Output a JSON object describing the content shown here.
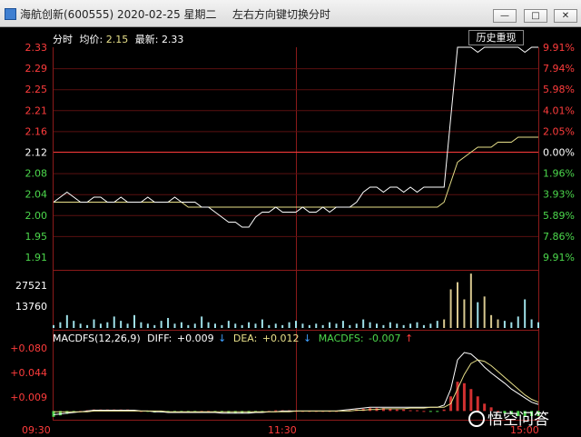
{
  "window": {
    "title": "海航创新(600555)  2020-02-25  星期二",
    "hint": "左右方向键切换分时",
    "min_glyph": "—",
    "max_glyph": "□",
    "close_glyph": "✕"
  },
  "info": {
    "mode": "分时",
    "avg_label": "均价:",
    "avg_value": "2.15",
    "latest_label": "最新:",
    "latest_value": "2.33"
  },
  "history_button": "历史重现",
  "price_axis": {
    "left": [
      "2.33",
      "2.29",
      "2.25",
      "2.21",
      "2.16",
      "2.12",
      "2.08",
      "2.04",
      "2.00",
      "1.95",
      "1.91"
    ],
    "right": [
      "9.91%",
      "7.94%",
      "5.98%",
      "4.01%",
      "2.05%",
      "0.00%",
      "1.96%",
      "3.93%",
      "5.89%",
      "7.86%",
      "9.91%"
    ]
  },
  "volume_axis": [
    "27521",
    "13760"
  ],
  "macd": {
    "title": "MACDFS(12,26,9)",
    "diff_label": "DIFF:",
    "diff_value": "+0.009",
    "dea_label": "DEA:",
    "dea_value": "+0.012",
    "macdfs_label": "MACDFS:",
    "macdfs_value": "-0.007",
    "axis": [
      "+0.080",
      "+0.044",
      "+0.009"
    ]
  },
  "time_axis": [
    "09:30",
    "11:30",
    "15:00"
  ],
  "watermark": "悟空问答",
  "colors": {
    "red": "#ff3c3c",
    "green": "#4cd84c",
    "white": "#ffffff",
    "yellow": "#e8e08a",
    "grid": "#8b1a1a",
    "volume": "#9fe0e8"
  },
  "chart_data": {
    "type": "line",
    "price": [
      2.02,
      2.03,
      2.04,
      2.03,
      2.02,
      2.02,
      2.03,
      2.03,
      2.02,
      2.02,
      2.03,
      2.02,
      2.02,
      2.02,
      2.03,
      2.02,
      2.02,
      2.02,
      2.03,
      2.02,
      2.02,
      2.02,
      2.01,
      2.01,
      2.0,
      1.99,
      1.98,
      1.98,
      1.97,
      1.97,
      1.99,
      2.0,
      2.0,
      2.01,
      2.0,
      2.0,
      2.0,
      2.01,
      2.0,
      2.0,
      2.01,
      2.0,
      2.01,
      2.01,
      2.01,
      2.02,
      2.04,
      2.05,
      2.05,
      2.04,
      2.05,
      2.05,
      2.04,
      2.05,
      2.04,
      2.05,
      2.05,
      2.05,
      2.05,
      2.19,
      2.33,
      2.33,
      2.33,
      2.32,
      2.33,
      2.33,
      2.33,
      2.33,
      2.33,
      2.33,
      2.32,
      2.33,
      2.33
    ],
    "avg": [
      2.02,
      2.02,
      2.02,
      2.02,
      2.02,
      2.02,
      2.02,
      2.02,
      2.02,
      2.02,
      2.02,
      2.02,
      2.02,
      2.02,
      2.02,
      2.02,
      2.02,
      2.02,
      2.02,
      2.02,
      2.01,
      2.01,
      2.01,
      2.01,
      2.01,
      2.01,
      2.01,
      2.01,
      2.01,
      2.01,
      2.01,
      2.01,
      2.01,
      2.01,
      2.01,
      2.01,
      2.01,
      2.01,
      2.01,
      2.01,
      2.01,
      2.01,
      2.01,
      2.01,
      2.01,
      2.01,
      2.01,
      2.01,
      2.01,
      2.01,
      2.01,
      2.01,
      2.01,
      2.01,
      2.01,
      2.01,
      2.01,
      2.01,
      2.02,
      2.06,
      2.1,
      2.11,
      2.12,
      2.13,
      2.13,
      2.13,
      2.14,
      2.14,
      2.14,
      2.15,
      2.15,
      2.15,
      2.15
    ],
    "prev_close": 2.12,
    "ylim": [
      1.91,
      2.33
    ],
    "volume": [
      2,
      4,
      9,
      5,
      3,
      2,
      6,
      3,
      4,
      8,
      5,
      3,
      9,
      4,
      3,
      2,
      5,
      7,
      3,
      4,
      2,
      3,
      8,
      4,
      3,
      2,
      5,
      3,
      2,
      4,
      3,
      6,
      2,
      3,
      2,
      4,
      5,
      3,
      2,
      3,
      2,
      4,
      3,
      5,
      2,
      3,
      6,
      4,
      3,
      2,
      4,
      3,
      2,
      3,
      4,
      2,
      3,
      5,
      6,
      27,
      32,
      20,
      38,
      18,
      22,
      9,
      6,
      5,
      4,
      8,
      20,
      6,
      4
    ],
    "volume_ylim": [
      0,
      40000
    ],
    "macd_hist": [
      -0.008,
      -0.006,
      -0.004,
      -0.002,
      0.0,
      0.001,
      0.002,
      0.002,
      0.002,
      0.002,
      0.002,
      0.002,
      0.001,
      0.0,
      -0.001,
      -0.002,
      -0.002,
      -0.002,
      -0.002,
      -0.002,
      -0.002,
      -0.001,
      0.0,
      0.0,
      -0.001,
      -0.002,
      -0.003,
      -0.003,
      -0.003,
      -0.003,
      -0.002,
      -0.001,
      0.0,
      0.001,
      0.001,
      0.001,
      0.0,
      0.0,
      0.0,
      0.0,
      0.0,
      0.0,
      0.0,
      0.001,
      0.001,
      0.002,
      0.003,
      0.004,
      0.004,
      0.004,
      0.003,
      0.002,
      0.002,
      0.001,
      0.001,
      0.0,
      -0.001,
      -0.001,
      0.002,
      0.02,
      0.04,
      0.038,
      0.03,
      0.02,
      0.01,
      0.005,
      0.0,
      -0.003,
      -0.005,
      -0.007,
      -0.007,
      -0.007,
      -0.007
    ],
    "macd_diff": [
      -0.005,
      -0.004,
      -0.003,
      -0.002,
      -0.001,
      0.0,
      0.001,
      0.001,
      0.001,
      0.001,
      0.001,
      0.001,
      0.001,
      0.0,
      0.0,
      -0.001,
      -0.001,
      -0.002,
      -0.002,
      -0.002,
      -0.002,
      -0.002,
      -0.002,
      -0.002,
      -0.002,
      -0.003,
      -0.003,
      -0.003,
      -0.003,
      -0.003,
      -0.002,
      -0.002,
      -0.001,
      -0.001,
      0.0,
      0.0,
      0.0,
      0.0,
      0.0,
      0.0,
      0.0,
      0.0,
      0.0,
      0.001,
      0.002,
      0.003,
      0.004,
      0.005,
      0.005,
      0.005,
      0.005,
      0.005,
      0.005,
      0.005,
      0.005,
      0.005,
      0.005,
      0.005,
      0.008,
      0.03,
      0.07,
      0.08,
      0.078,
      0.07,
      0.06,
      0.052,
      0.045,
      0.038,
      0.03,
      0.024,
      0.018,
      0.012,
      0.009
    ],
    "macd_dea": [
      -0.001,
      -0.001,
      -0.001,
      -0.001,
      -0.001,
      -0.001,
      0.0,
      0.0,
      0.0,
      0.0,
      0.0,
      0.0,
      0.0,
      0.0,
      0.0,
      0.0,
      0.0,
      -0.001,
      -0.001,
      -0.001,
      -0.001,
      -0.001,
      -0.001,
      -0.001,
      -0.001,
      -0.001,
      -0.001,
      -0.001,
      -0.001,
      -0.001,
      -0.001,
      -0.001,
      -0.001,
      -0.001,
      -0.001,
      -0.001,
      0.0,
      0.0,
      0.0,
      0.0,
      0.0,
      0.0,
      0.0,
      0.0,
      0.0,
      0.001,
      0.001,
      0.002,
      0.002,
      0.003,
      0.003,
      0.003,
      0.003,
      0.004,
      0.004,
      0.004,
      0.005,
      0.005,
      0.005,
      0.01,
      0.03,
      0.05,
      0.065,
      0.07,
      0.068,
      0.062,
      0.054,
      0.046,
      0.038,
      0.03,
      0.022,
      0.016,
      0.012
    ],
    "macd_ylim": [
      -0.012,
      0.09
    ]
  }
}
